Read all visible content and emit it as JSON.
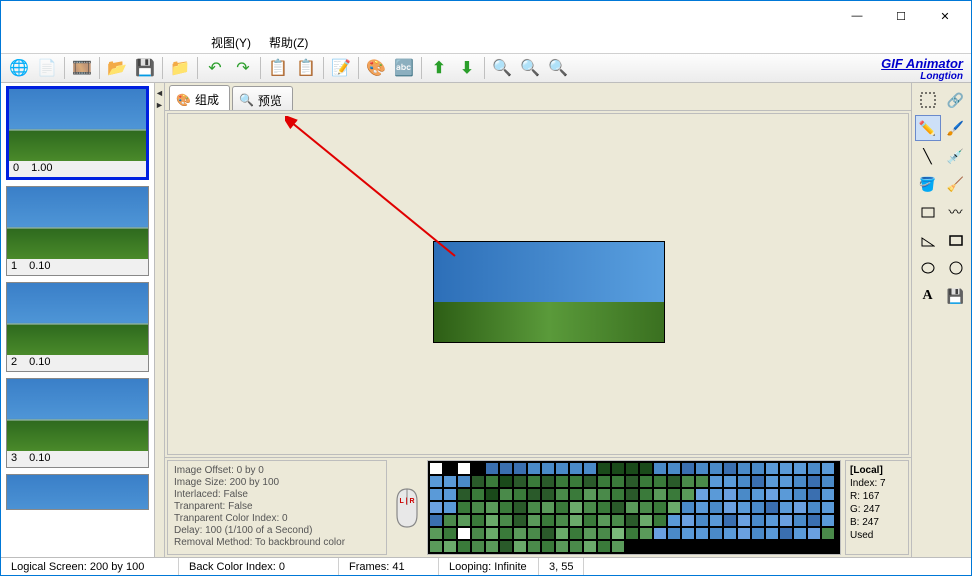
{
  "titlebar": {
    "minimize": "—",
    "maximize": "☐",
    "close": "✕"
  },
  "menu": {
    "view": "视图(Y)",
    "help": "帮助(Z)"
  },
  "brand": {
    "line1": "GIF Animator",
    "line2": "Longtion"
  },
  "tabs": {
    "compose": "组成",
    "preview": "预览"
  },
  "frames": [
    {
      "idx": "0",
      "delay": "1.00",
      "selected": true
    },
    {
      "idx": "1",
      "delay": "0.10",
      "selected": false
    },
    {
      "idx": "2",
      "delay": "0.10",
      "selected": false
    },
    {
      "idx": "3",
      "delay": "0.10",
      "selected": false
    }
  ],
  "info": {
    "offset": "Image Offset: 0 by 0",
    "size": "Image Size: 200 by 100",
    "interlaced": "Interlaced: False",
    "transparent": "Tranparent: False",
    "transIndex": "Tranparent Color Index: 0",
    "delay": "Delay: 100 (1/100 of a Second)",
    "removal": "Removal Method: To backbround color"
  },
  "mouseLabel": "L | R",
  "palette": {
    "title": "[Local]",
    "index": "Index: 7",
    "r": "R: 167",
    "g": "G: 247",
    "b": "B: 247",
    "used": "Used"
  },
  "paletteColors": [
    "#fff",
    "#000",
    "#fff",
    "#000",
    "#3a6fb0",
    "#3a6fb0",
    "#3a6fb0",
    "#4a8ac8",
    "#4a8ac8",
    "#4a8ac8",
    "#4a8ac8",
    "#4a8ac8",
    "#1a4a1a",
    "#1a4a1a",
    "#1a4a1a",
    "#1a4a1a",
    "#4a8ac8",
    "#4a8ac8",
    "#3a6fb0",
    "#4a8ac8",
    "#4a8ac8",
    "#3a6fb0",
    "#4a8ac8",
    "#4a8ac8",
    "#5a9ad8",
    "#5a9ad8",
    "#5a9ad8",
    "#4a8ac8",
    "#5a9ad8",
    "#5a9ad8",
    "#5a9ad8",
    "#4a8ac8",
    "#2a5a2a",
    "#3a7a3a",
    "#1a4a1a",
    "#2a5a2a",
    "#3a7a3a",
    "#2a5a2a",
    "#3a7a3a",
    "#3a7a3a",
    "#2a5a2a",
    "#3a7a3a",
    "#3a7a3a",
    "#2a5a2a",
    "#3a7a3a",
    "#3a7a3a",
    "#2a5a2a",
    "#4a8a4a",
    "#4a8a4a",
    "#5a9ad8",
    "#5a9ad8",
    "#4a8ac8",
    "#3a6fb0",
    "#5a9ad8",
    "#5a9ad8",
    "#4a8ac8",
    "#3a6fb0",
    "#4a8ac8",
    "#5a9ad8",
    "#5a9ad8",
    "#2a5a2a",
    "#3a7a3a",
    "#1a4a1a",
    "#4a8a4a",
    "#3a7a3a",
    "#2a5a2a",
    "#2a5a2a",
    "#4a8a4a",
    "#3a7a3a",
    "#5a9a5a",
    "#4a8a4a",
    "#3a7a3a",
    "#2a5a2a",
    "#3a7a3a",
    "#5a9a5a",
    "#3a7a3a",
    "#5a9a5a",
    "#6aa0e0",
    "#5a9ad8",
    "#6aa0e0",
    "#4a8ac8",
    "#5a9ad8",
    "#6aa0e0",
    "#5a9ad8",
    "#4a8ac8",
    "#3a6fb0",
    "#5a9ad8",
    "#6aa0e0",
    "#5a9ad8",
    "#3a7a3a",
    "#4a8a4a",
    "#5a9a5a",
    "#3a7a3a",
    "#2a5a2a",
    "#4a8a4a",
    "#5a9a5a",
    "#3a7a3a",
    "#6aaa6a",
    "#4a8a4a",
    "#3a7a3a",
    "#2a5a2a",
    "#5a9a5a",
    "#4a8a4a",
    "#3a7a3a",
    "#6aaa6a",
    "#4a8ac8",
    "#5a9ad8",
    "#4a8ac8",
    "#6aa0e0",
    "#5a9ad8",
    "#4a8ac8",
    "#3a6fb0",
    "#5a9ad8",
    "#6aa0e0",
    "#4a8ac8",
    "#5a9ad8",
    "#3a6fb0",
    "#4a8a4a",
    "#5a9a5a",
    "#3a7a3a",
    "#6aaa6a",
    "#4a8a4a",
    "#2a5a2a",
    "#5a9a5a",
    "#3a7a3a",
    "#4a8a4a",
    "#6aaa6a",
    "#3a7a3a",
    "#5a9a5a",
    "#4a8a4a",
    "#2a5a2a",
    "#6aaa6a",
    "#3a7a3a",
    "#5a9ad8",
    "#6aa0e0",
    "#4a8ac8",
    "#5a9ad8",
    "#3a6fb0",
    "#6aa0e0",
    "#4a8ac8",
    "#5a9ad8",
    "#6aa0e0",
    "#4a8ac8",
    "#3a6fb0",
    "#5a9ad8",
    "#5a9a5a",
    "#3a7a3a",
    "#fff",
    "#4a8a4a",
    "#6aaa6a",
    "#3a7a3a",
    "#5a9a5a",
    "#4a8a4a",
    "#2a5a2a",
    "#6aaa6a",
    "#3a7a3a",
    "#5a9a5a",
    "#4a8a4a",
    "#7aba7a",
    "#3a7a3a",
    "#5a9a5a",
    "#6aa0e0",
    "#4a8ac8",
    "#5a9ad8",
    "#5a9ad8",
    "#4a8ac8",
    "#5a9ad8",
    "#6aa0e0",
    "#4a8ac8",
    "#5a9ad8",
    "#3a6fb0",
    "#5a9ad8",
    "#6aa0e0",
    "#4a8a4a",
    "#5a9a5a",
    "#6aaa6a",
    "#3a7a3a",
    "#4a8a4a",
    "#5a9a5a",
    "#2a5a2a",
    "#6aaa6a",
    "#4a8a4a",
    "#3a7a3a",
    "#5a9a5a",
    "#4a8a4a",
    "#6aaa6a",
    "#3a7a3a",
    "#5a9a5a"
  ],
  "status": {
    "screen": "Logical Screen: 200 by 100",
    "backColor": "Back Color Index: 0",
    "frames": "Frames: 41",
    "looping": "Looping: Infinite",
    "coords": "3, 55"
  }
}
